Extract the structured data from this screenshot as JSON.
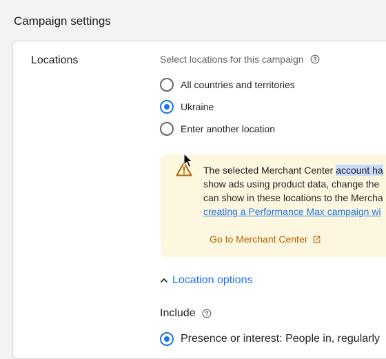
{
  "page": {
    "title": "Campaign settings"
  },
  "locations": {
    "label": "Locations",
    "prompt": "Select locations for this campaign",
    "options": [
      {
        "label": "All countries and territories",
        "selected": false
      },
      {
        "label": "Ukraine",
        "selected": true
      },
      {
        "label": "Enter another location",
        "selected": false
      }
    ],
    "warning": {
      "icon": "warning-triangle-icon",
      "line1_pre": "The selected Merchant Center ",
      "line1_highlight": "account ha",
      "line2": "show ads using product data, change the",
      "line3": "can show in these locations to the Mercha",
      "link": "creating a Performance Max campaign wi",
      "merchant_link": "Go to Merchant Center",
      "background": "#fef7e0",
      "accent": "#b06000"
    },
    "location_options_label": "Location options",
    "include": {
      "label": "Include",
      "option": "Presence or interest: People in, regularly"
    }
  },
  "colors": {
    "primary": "#1a73e8",
    "text": "#202124",
    "secondary": "#5f6368"
  }
}
